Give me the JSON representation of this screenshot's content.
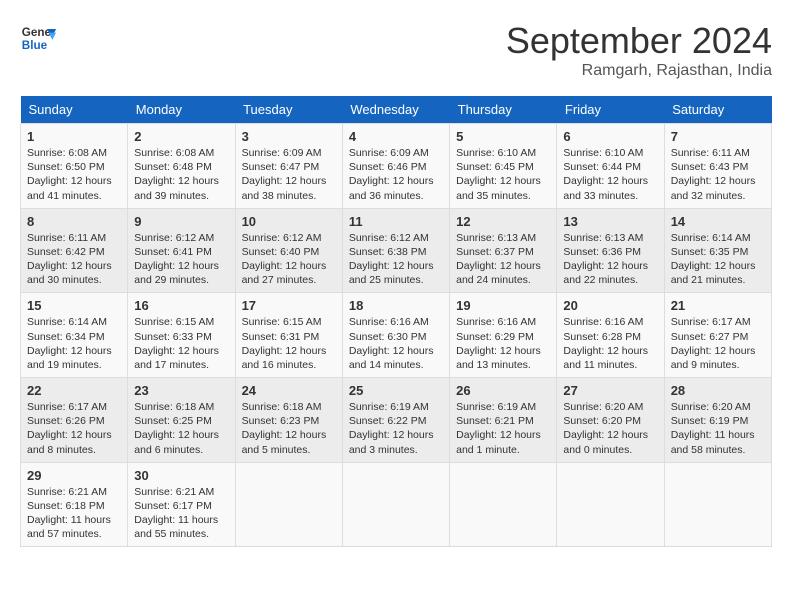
{
  "header": {
    "logo_line1": "General",
    "logo_line2": "Blue",
    "month": "September 2024",
    "location": "Ramgarh, Rajasthan, India"
  },
  "days_of_week": [
    "Sunday",
    "Monday",
    "Tuesday",
    "Wednesday",
    "Thursday",
    "Friday",
    "Saturday"
  ],
  "weeks": [
    [
      {
        "day": "1",
        "info": "Sunrise: 6:08 AM\nSunset: 6:50 PM\nDaylight: 12 hours\nand 41 minutes."
      },
      {
        "day": "2",
        "info": "Sunrise: 6:08 AM\nSunset: 6:48 PM\nDaylight: 12 hours\nand 39 minutes."
      },
      {
        "day": "3",
        "info": "Sunrise: 6:09 AM\nSunset: 6:47 PM\nDaylight: 12 hours\nand 38 minutes."
      },
      {
        "day": "4",
        "info": "Sunrise: 6:09 AM\nSunset: 6:46 PM\nDaylight: 12 hours\nand 36 minutes."
      },
      {
        "day": "5",
        "info": "Sunrise: 6:10 AM\nSunset: 6:45 PM\nDaylight: 12 hours\nand 35 minutes."
      },
      {
        "day": "6",
        "info": "Sunrise: 6:10 AM\nSunset: 6:44 PM\nDaylight: 12 hours\nand 33 minutes."
      },
      {
        "day": "7",
        "info": "Sunrise: 6:11 AM\nSunset: 6:43 PM\nDaylight: 12 hours\nand 32 minutes."
      }
    ],
    [
      {
        "day": "8",
        "info": "Sunrise: 6:11 AM\nSunset: 6:42 PM\nDaylight: 12 hours\nand 30 minutes."
      },
      {
        "day": "9",
        "info": "Sunrise: 6:12 AM\nSunset: 6:41 PM\nDaylight: 12 hours\nand 29 minutes."
      },
      {
        "day": "10",
        "info": "Sunrise: 6:12 AM\nSunset: 6:40 PM\nDaylight: 12 hours\nand 27 minutes."
      },
      {
        "day": "11",
        "info": "Sunrise: 6:12 AM\nSunset: 6:38 PM\nDaylight: 12 hours\nand 25 minutes."
      },
      {
        "day": "12",
        "info": "Sunrise: 6:13 AM\nSunset: 6:37 PM\nDaylight: 12 hours\nand 24 minutes."
      },
      {
        "day": "13",
        "info": "Sunrise: 6:13 AM\nSunset: 6:36 PM\nDaylight: 12 hours\nand 22 minutes."
      },
      {
        "day": "14",
        "info": "Sunrise: 6:14 AM\nSunset: 6:35 PM\nDaylight: 12 hours\nand 21 minutes."
      }
    ],
    [
      {
        "day": "15",
        "info": "Sunrise: 6:14 AM\nSunset: 6:34 PM\nDaylight: 12 hours\nand 19 minutes."
      },
      {
        "day": "16",
        "info": "Sunrise: 6:15 AM\nSunset: 6:33 PM\nDaylight: 12 hours\nand 17 minutes."
      },
      {
        "day": "17",
        "info": "Sunrise: 6:15 AM\nSunset: 6:31 PM\nDaylight: 12 hours\nand 16 minutes."
      },
      {
        "day": "18",
        "info": "Sunrise: 6:16 AM\nSunset: 6:30 PM\nDaylight: 12 hours\nand 14 minutes."
      },
      {
        "day": "19",
        "info": "Sunrise: 6:16 AM\nSunset: 6:29 PM\nDaylight: 12 hours\nand 13 minutes."
      },
      {
        "day": "20",
        "info": "Sunrise: 6:16 AM\nSunset: 6:28 PM\nDaylight: 12 hours\nand 11 minutes."
      },
      {
        "day": "21",
        "info": "Sunrise: 6:17 AM\nSunset: 6:27 PM\nDaylight: 12 hours\nand 9 minutes."
      }
    ],
    [
      {
        "day": "22",
        "info": "Sunrise: 6:17 AM\nSunset: 6:26 PM\nDaylight: 12 hours\nand 8 minutes."
      },
      {
        "day": "23",
        "info": "Sunrise: 6:18 AM\nSunset: 6:25 PM\nDaylight: 12 hours\nand 6 minutes."
      },
      {
        "day": "24",
        "info": "Sunrise: 6:18 AM\nSunset: 6:23 PM\nDaylight: 12 hours\nand 5 minutes."
      },
      {
        "day": "25",
        "info": "Sunrise: 6:19 AM\nSunset: 6:22 PM\nDaylight: 12 hours\nand 3 minutes."
      },
      {
        "day": "26",
        "info": "Sunrise: 6:19 AM\nSunset: 6:21 PM\nDaylight: 12 hours\nand 1 minute."
      },
      {
        "day": "27",
        "info": "Sunrise: 6:20 AM\nSunset: 6:20 PM\nDaylight: 12 hours\nand 0 minutes."
      },
      {
        "day": "28",
        "info": "Sunrise: 6:20 AM\nSunset: 6:19 PM\nDaylight: 11 hours\nand 58 minutes."
      }
    ],
    [
      {
        "day": "29",
        "info": "Sunrise: 6:21 AM\nSunset: 6:18 PM\nDaylight: 11 hours\nand 57 minutes."
      },
      {
        "day": "30",
        "info": "Sunrise: 6:21 AM\nSunset: 6:17 PM\nDaylight: 11 hours\nand 55 minutes."
      },
      {
        "day": "",
        "info": ""
      },
      {
        "day": "",
        "info": ""
      },
      {
        "day": "",
        "info": ""
      },
      {
        "day": "",
        "info": ""
      },
      {
        "day": "",
        "info": ""
      }
    ]
  ]
}
